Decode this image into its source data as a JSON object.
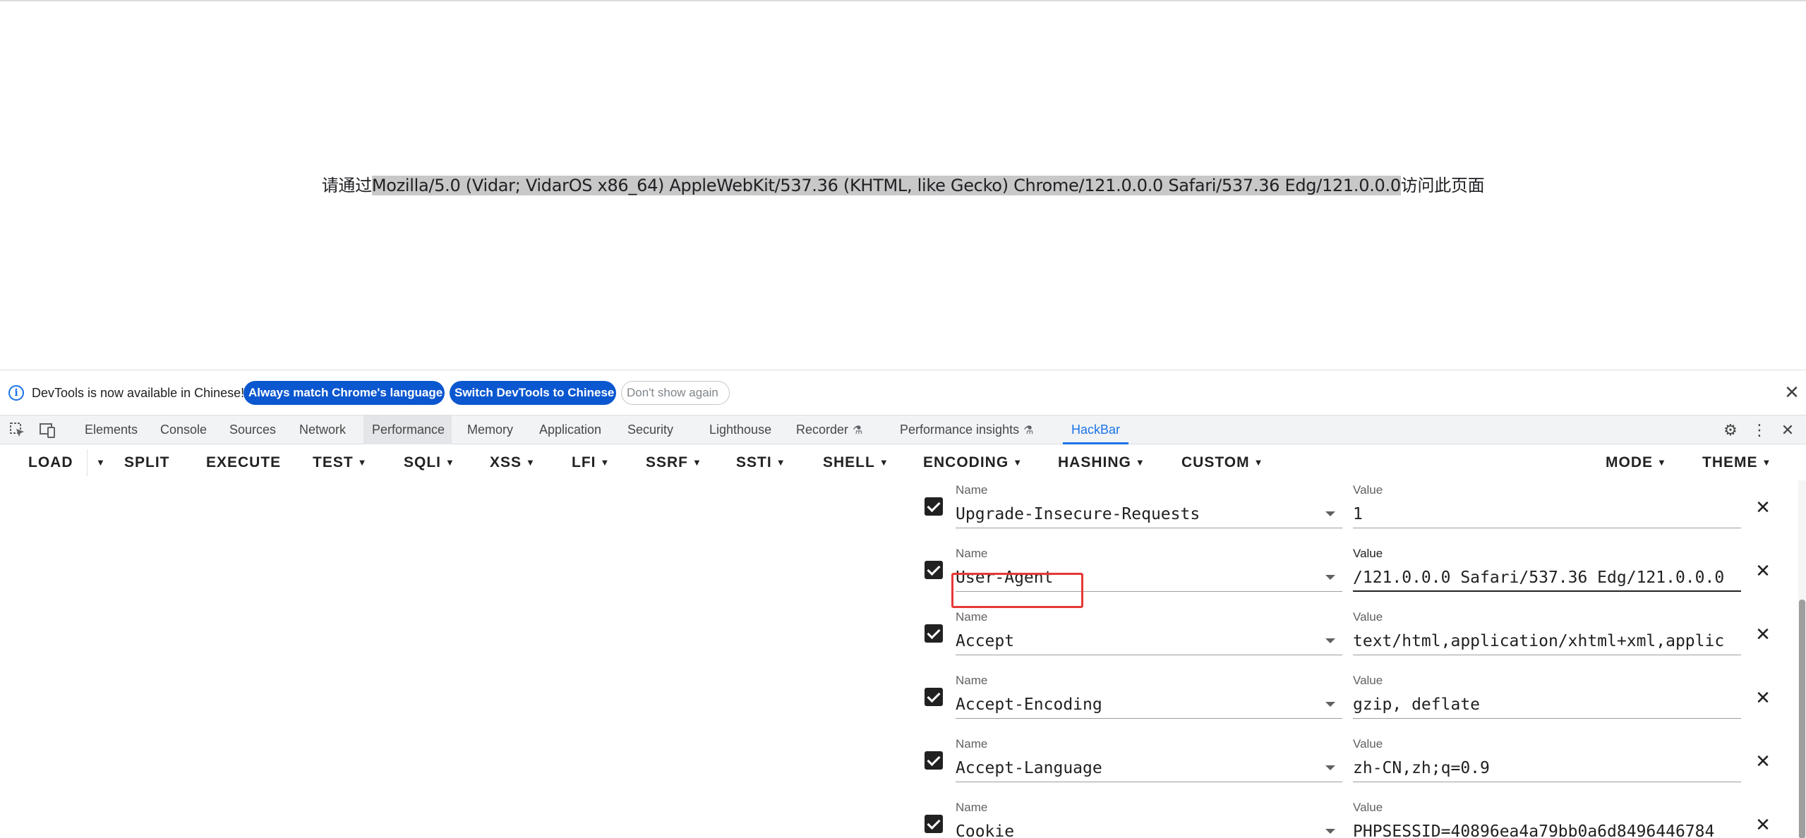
{
  "page": {
    "message_prefix": "请通过",
    "user_agent_highlight": "Mozilla/5.0 (Vidar; VidarOS x86_64) AppleWebKit/537.36 (KHTML, like Gecko) Chrome/121.0.0.0 Safari/537.36 Edg/121.0.0.0",
    "message_suffix": "访问此页面"
  },
  "infobar": {
    "icon": "info-icon",
    "text": "DevTools is now available in Chinese!",
    "match_language_button": "Always match Chrome's language",
    "switch_button": "Switch DevTools to Chinese",
    "dont_show_button": "Don't show again",
    "close_icon": "close-icon"
  },
  "devtools_tabs": {
    "left_icons": [
      "inspect-element-icon",
      "device-toolbar-icon"
    ],
    "items": [
      {
        "label": "Elements"
      },
      {
        "label": "Console"
      },
      {
        "label": "Sources"
      },
      {
        "label": "Network"
      },
      {
        "label": "Performance"
      },
      {
        "label": "Memory"
      },
      {
        "label": "Application"
      },
      {
        "label": "Security"
      },
      {
        "label": "Lighthouse"
      },
      {
        "label": "Recorder"
      },
      {
        "label": "Performance insights"
      },
      {
        "label": "HackBar"
      }
    ],
    "active": "HackBar",
    "right_icons": [
      "gear-icon",
      "more-vertical-icon",
      "close-icon"
    ]
  },
  "hackbar": {
    "toolbar": {
      "load": "LOAD",
      "split": "SPLIT",
      "execute": "EXECUTE",
      "test": "TEST",
      "sqli": "SQLI",
      "xss": "XSS",
      "lfi": "LFI",
      "ssrf": "SSRF",
      "ssti": "SSTI",
      "shell": "SHELL",
      "encoding": "ENCODING",
      "hashing": "HASHING",
      "custom": "CUSTOM",
      "mode": "MODE",
      "theme": "THEME"
    },
    "headers": [
      {
        "name_label": "Name",
        "value_label": "Value",
        "name": "Upgrade-Insecure-Requests",
        "value": "1",
        "checked": true
      },
      {
        "name_label": "Name",
        "value_label": "Value",
        "name": "User-Agent",
        "value": "/121.0.0.0 Safari/537.36 Edg/121.0.0.0",
        "checked": true
      },
      {
        "name_label": "Name",
        "value_label": "Value",
        "name": "Accept",
        "value": "text/html,application/xhtml+xml,applic",
        "checked": true
      },
      {
        "name_label": "Name",
        "value_label": "Value",
        "name": "Accept-Encoding",
        "value": "gzip, deflate",
        "checked": true
      },
      {
        "name_label": "Name",
        "value_label": "Value",
        "name": "Accept-Language",
        "value": "zh-CN,zh;q=0.9",
        "checked": true
      },
      {
        "name_label": "Name",
        "value_label": "Value",
        "name": "Cookie",
        "value": "PHPSESSID=40896ea4a79bb0a6d8496446784",
        "checked": true
      }
    ]
  },
  "colors": {
    "accent": "#1a73e8",
    "button_blue": "#0b57d0",
    "highlight_box": "#e53935"
  }
}
